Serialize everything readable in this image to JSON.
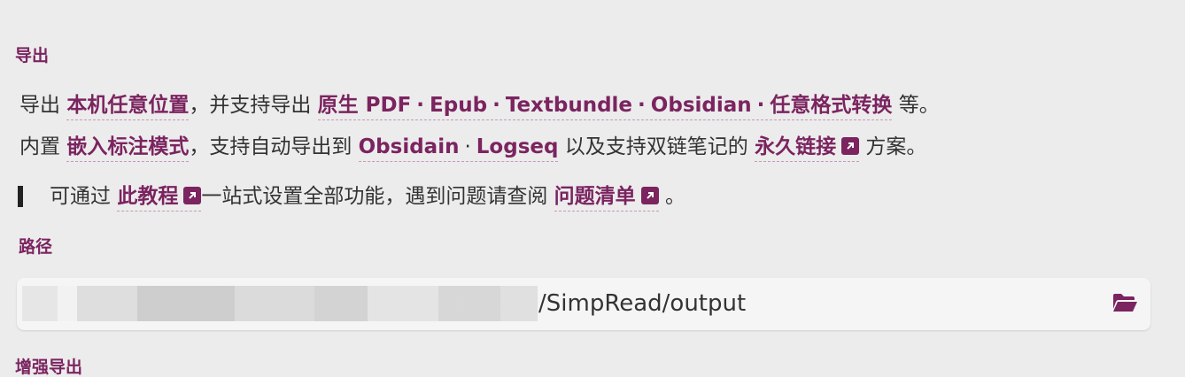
{
  "export_section": {
    "title": "导出",
    "line1": {
      "prefix": "导出",
      "link_location": "本机任意位置",
      "middle": "，并支持导出",
      "formats": [
        "原生 PDF",
        "Epub",
        "Textbundle",
        "Obsidian",
        "任意格式转换"
      ],
      "separator": "·",
      "suffix": "等。"
    },
    "line2": {
      "prefix": "内置",
      "link_annotate": "嵌入标注模式",
      "middle": "，支持自动导出到",
      "targets": [
        "Obsidain",
        "Logseq"
      ],
      "middle2": "以及支持双链笔记的",
      "link_permalink": "永久链接",
      "suffix": "方案。"
    },
    "note": {
      "prefix": "可通过",
      "link_tutorial": "此教程",
      "middle": "一站式设置全部功能，遇到问题请查阅",
      "link_faq": "问题清单",
      "suffix": "。"
    }
  },
  "path_section": {
    "title": "路径",
    "value_visible": "/SimpRead/output",
    "browse_icon": "folder-open-icon"
  },
  "enhanced_section": {
    "title": "增强导出"
  },
  "colors": {
    "accent": "#7b2460",
    "background": "#ececec",
    "field": "#f5f5f5"
  }
}
